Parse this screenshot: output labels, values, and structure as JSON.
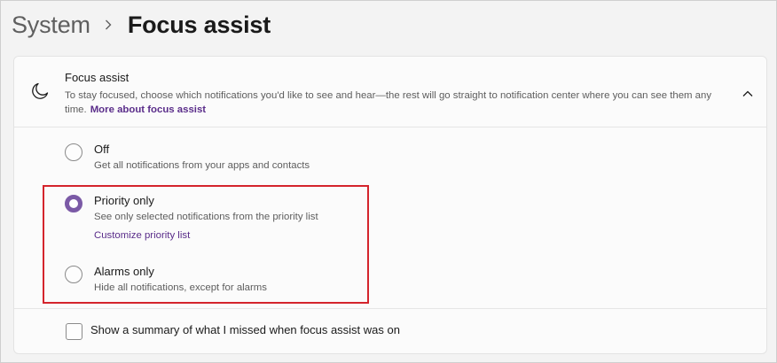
{
  "breadcrumb": {
    "parent": "System",
    "current": "Focus assist"
  },
  "header": {
    "title": "Focus assist",
    "description": "To stay focused, choose which notifications you'd like to see and hear—the rest will go straight to notification center where you can see them any time.",
    "link": "More about focus assist",
    "expanded": true
  },
  "options": [
    {
      "label": "Off",
      "description": "Get all notifications from your apps and contacts",
      "selected": false
    },
    {
      "label": "Priority only",
      "description": "See only selected notifications from the priority list",
      "link": "Customize priority list",
      "selected": true
    },
    {
      "label": "Alarms only",
      "description": "Hide all notifications, except for alarms",
      "selected": false
    }
  ],
  "summary_checkbox": {
    "label": "Show a summary of what I missed when focus assist was on",
    "checked": false
  },
  "colors": {
    "accent": "#7b5aa6",
    "link": "#5a2d8a",
    "highlight_box": "#d4242c"
  },
  "icons": {
    "header": "moon-icon",
    "toggle": "chevron-up-icon",
    "separator": "chevron-right-icon"
  }
}
